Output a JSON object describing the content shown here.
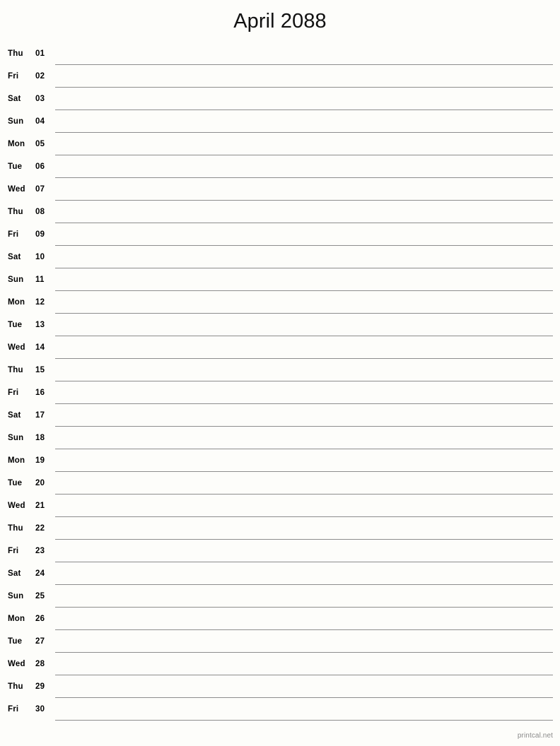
{
  "document": {
    "title": "April 2088",
    "footer": "printcal.net",
    "accent_color": "#8d8d8d",
    "background_color": "#fdfdfa",
    "text_color": "#000000",
    "footer_color": "#8a8a8a"
  },
  "rows": [
    {
      "dow": "Thu",
      "day": "01"
    },
    {
      "dow": "Fri",
      "day": "02"
    },
    {
      "dow": "Sat",
      "day": "03"
    },
    {
      "dow": "Sun",
      "day": "04"
    },
    {
      "dow": "Mon",
      "day": "05"
    },
    {
      "dow": "Tue",
      "day": "06"
    },
    {
      "dow": "Wed",
      "day": "07"
    },
    {
      "dow": "Thu",
      "day": "08"
    },
    {
      "dow": "Fri",
      "day": "09"
    },
    {
      "dow": "Sat",
      "day": "10"
    },
    {
      "dow": "Sun",
      "day": "11"
    },
    {
      "dow": "Mon",
      "day": "12"
    },
    {
      "dow": "Tue",
      "day": "13"
    },
    {
      "dow": "Wed",
      "day": "14"
    },
    {
      "dow": "Thu",
      "day": "15"
    },
    {
      "dow": "Fri",
      "day": "16"
    },
    {
      "dow": "Sat",
      "day": "17"
    },
    {
      "dow": "Sun",
      "day": "18"
    },
    {
      "dow": "Mon",
      "day": "19"
    },
    {
      "dow": "Tue",
      "day": "20"
    },
    {
      "dow": "Wed",
      "day": "21"
    },
    {
      "dow": "Thu",
      "day": "22"
    },
    {
      "dow": "Fri",
      "day": "23"
    },
    {
      "dow": "Sat",
      "day": "24"
    },
    {
      "dow": "Sun",
      "day": "25"
    },
    {
      "dow": "Mon",
      "day": "26"
    },
    {
      "dow": "Tue",
      "day": "27"
    },
    {
      "dow": "Wed",
      "day": "28"
    },
    {
      "dow": "Thu",
      "day": "29"
    },
    {
      "dow": "Fri",
      "day": "30"
    }
  ]
}
